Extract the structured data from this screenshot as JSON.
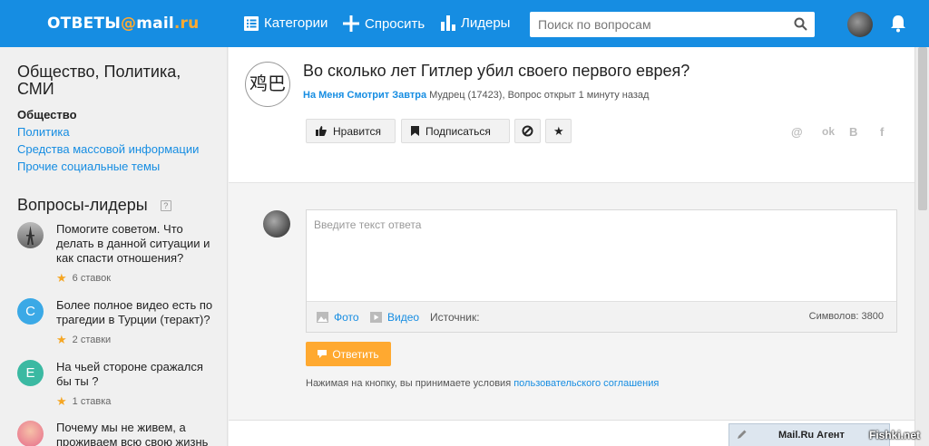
{
  "header": {
    "logo_left": "ОТВЕТЫ",
    "logo_at": "@",
    "logo_mail": "mail",
    "logo_dot": ".ru",
    "nav": [
      {
        "label": "Категории",
        "icon": "list-icon"
      },
      {
        "label": "Спросить",
        "icon": "plus-icon"
      },
      {
        "label": "Лидеры",
        "icon": "bar-chart-icon"
      }
    ],
    "search_placeholder": "Поиск по вопросам"
  },
  "sidebar": {
    "title": "Общество, Политика, СМИ",
    "links": [
      {
        "label": "Общество",
        "active": true
      },
      {
        "label": "Политика",
        "active": false
      },
      {
        "label": "Средства массовой информации",
        "active": false
      },
      {
        "label": "Прочие социальные темы",
        "active": false
      }
    ],
    "leaders_title": "Вопросы-лидеры",
    "leaders_help": "?",
    "leaders": [
      {
        "text": "Помогите советом. Что делать в данной ситуации и как спасти отношения?",
        "stars": "6 ставок",
        "avatar_letter": "",
        "avatar_color": "#888888"
      },
      {
        "text": "Более полное видео есть по трагедии в Турции (теракт)?",
        "stars": "2 ставки",
        "avatar_letter": "С",
        "avatar_color": "#3ba9e6"
      },
      {
        "text": "На чьей стороне сражался бы ты ?",
        "stars": "1 ставка",
        "avatar_letter": "Е",
        "avatar_color": "#3bb9a2"
      },
      {
        "text": "Почему мы не живем, а проживаем всю свою жизнь",
        "stars": "",
        "avatar_letter": "",
        "avatar_color": "#e66a8a"
      }
    ]
  },
  "question": {
    "avatar_glyph": "鸡巴",
    "title": "Во сколько лет Гитлер убил своего первого еврея?",
    "author": "На Меня Смотрит Завтра",
    "meta": " Мудрец (17423), Вопрос открыт 1 минуту назад",
    "like_label": "Нравится",
    "subscribe_label": "Подписаться",
    "share": [
      "@",
      "ok",
      "В",
      "f"
    ]
  },
  "answer": {
    "placeholder": "Введите текст ответа",
    "photo_label": "Фото",
    "video_label": "Видео",
    "source_label": "Источник:",
    "chars_label": "Символов: 3800",
    "reply_label": "Ответить",
    "terms_text": "Нажимая на кнопку, вы принимаете условия ",
    "terms_link": "пользовательского соглашения"
  },
  "agent": {
    "label": "Mail.Ru Агент"
  },
  "watermark": "Fishki.net",
  "colors": {
    "brand": "#168de2",
    "accent": "#ffa930"
  }
}
